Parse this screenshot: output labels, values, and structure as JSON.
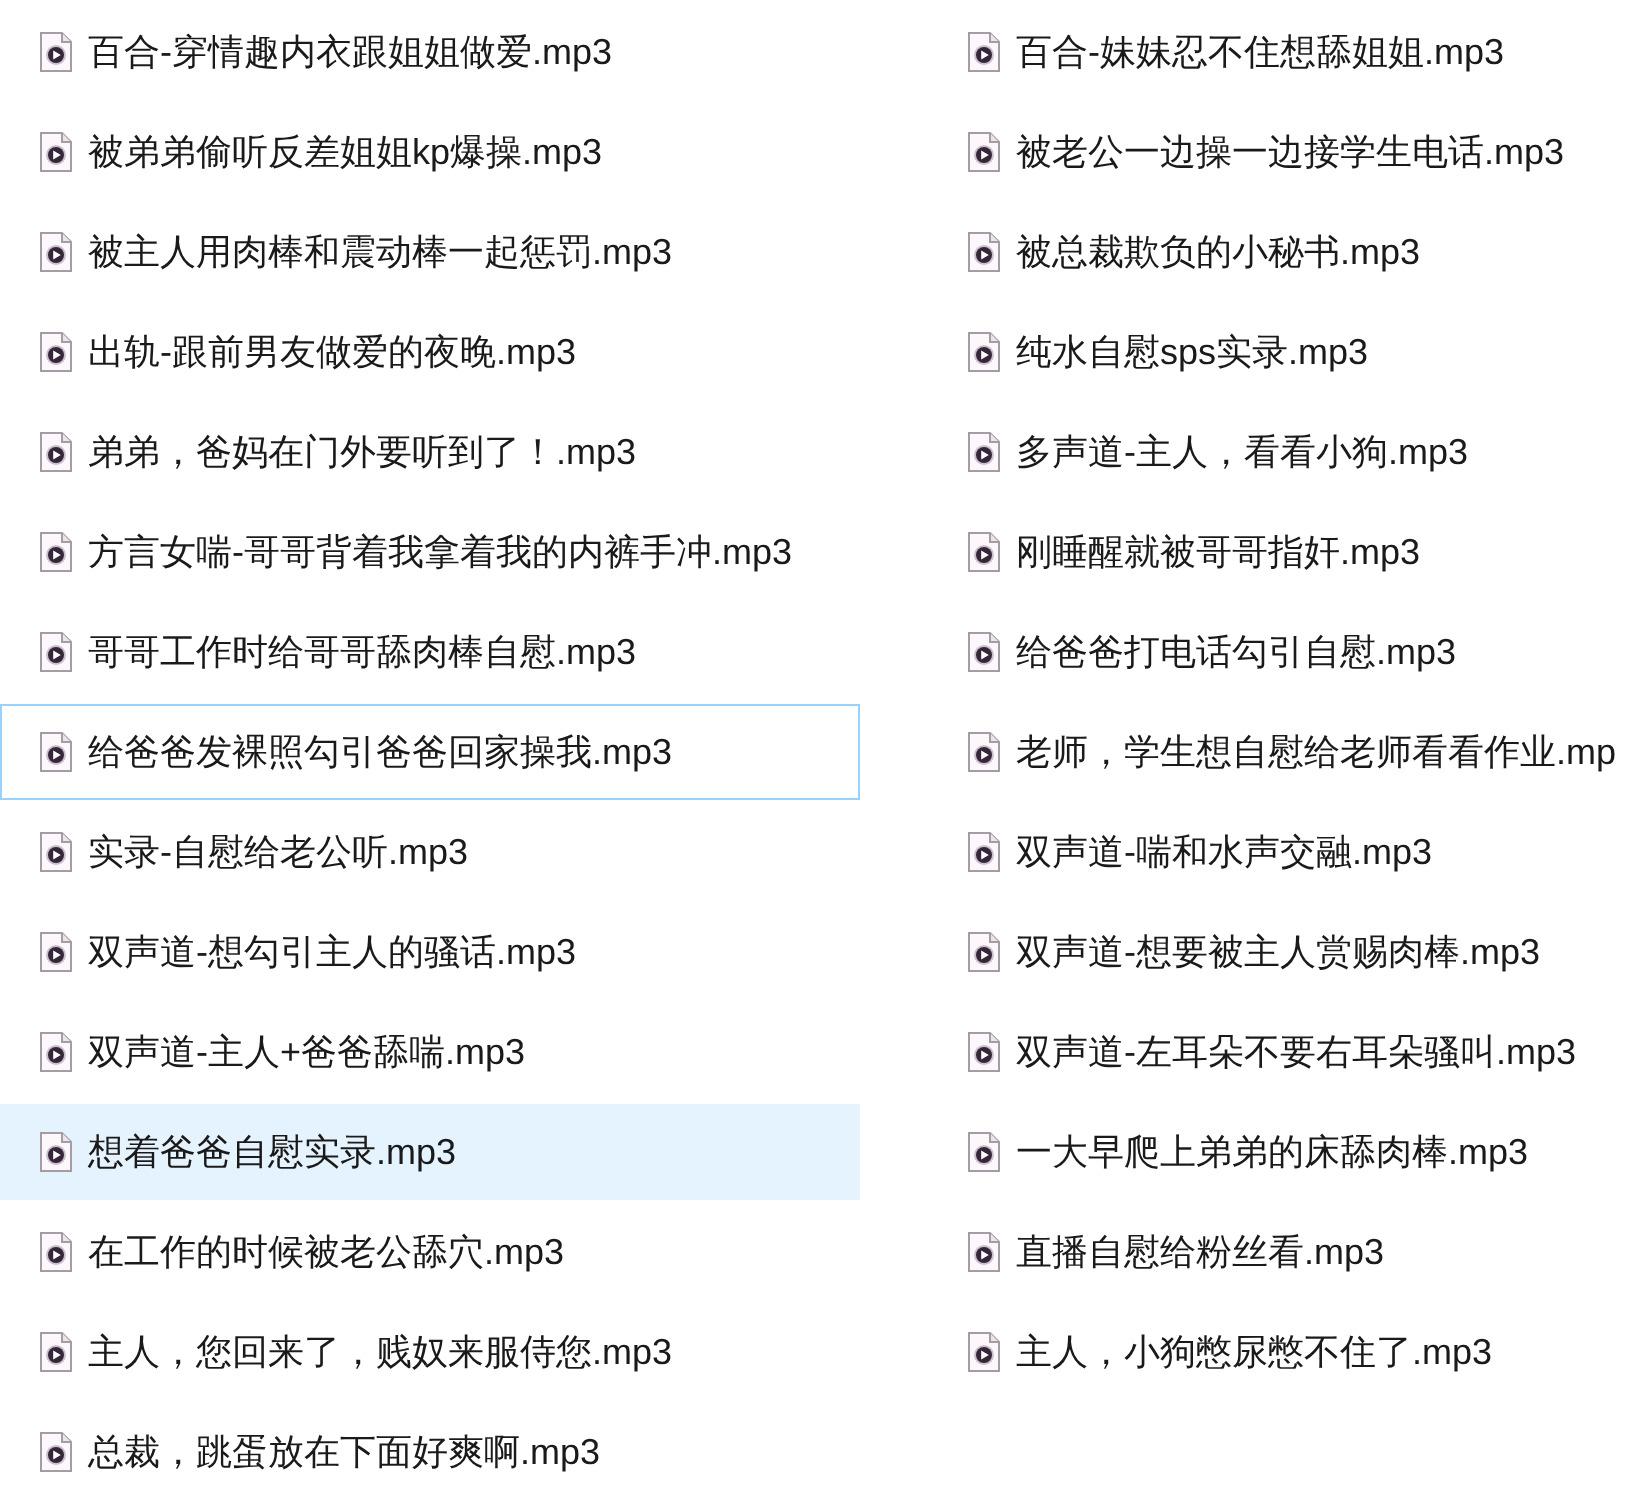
{
  "files": [
    {
      "name": "百合-穿情趣内衣跟姐姐做爱.mp3",
      "selected": false,
      "hovered": false,
      "focused": false
    },
    {
      "name": "百合-妹妹忍不住想舔姐姐.mp3",
      "selected": false,
      "hovered": false,
      "focused": false
    },
    {
      "name": "被弟弟偷听反差姐姐kp爆操.mp3",
      "selected": false,
      "hovered": false,
      "focused": false
    },
    {
      "name": "被老公一边操一边接学生电话.mp3",
      "selected": false,
      "hovered": false,
      "focused": false
    },
    {
      "name": "被主人用肉棒和震动棒一起惩罚.mp3",
      "selected": false,
      "hovered": false,
      "focused": false
    },
    {
      "name": "被总裁欺负的小秘书.mp3",
      "selected": false,
      "hovered": false,
      "focused": false
    },
    {
      "name": "出轨-跟前男友做爱的夜晚.mp3",
      "selected": false,
      "hovered": false,
      "focused": false
    },
    {
      "name": "纯水自慰sps实录.mp3",
      "selected": false,
      "hovered": false,
      "focused": false
    },
    {
      "name": "弟弟，爸妈在门外要听到了！.mp3",
      "selected": false,
      "hovered": false,
      "focused": false
    },
    {
      "name": "多声道-主人，看看小狗.mp3",
      "selected": false,
      "hovered": false,
      "focused": false
    },
    {
      "name": "方言女喘-哥哥背着我拿着我的内裤手冲.mp3",
      "selected": false,
      "hovered": false,
      "focused": false
    },
    {
      "name": "刚睡醒就被哥哥指奸.mp3",
      "selected": false,
      "hovered": false,
      "focused": false
    },
    {
      "name": "哥哥工作时给哥哥舔肉棒自慰.mp3",
      "selected": false,
      "hovered": false,
      "focused": false
    },
    {
      "name": "给爸爸打电话勾引自慰.mp3",
      "selected": false,
      "hovered": false,
      "focused": false
    },
    {
      "name": "给爸爸发裸照勾引爸爸回家操我.mp3",
      "selected": false,
      "hovered": false,
      "focused": true
    },
    {
      "name": "老师，学生想自慰给老师看看作业.mp",
      "selected": false,
      "hovered": false,
      "focused": false
    },
    {
      "name": "实录-自慰给老公听.mp3",
      "selected": false,
      "hovered": false,
      "focused": false
    },
    {
      "name": "双声道-喘和水声交融.mp3",
      "selected": false,
      "hovered": false,
      "focused": false
    },
    {
      "name": "双声道-想勾引主人的骚话.mp3",
      "selected": false,
      "hovered": false,
      "focused": false
    },
    {
      "name": "双声道-想要被主人赏赐肉棒.mp3",
      "selected": false,
      "hovered": false,
      "focused": false
    },
    {
      "name": "双声道-主人+爸爸舔喘.mp3",
      "selected": false,
      "hovered": false,
      "focused": false
    },
    {
      "name": "双声道-左耳朵不要右耳朵骚叫.mp3",
      "selected": false,
      "hovered": false,
      "focused": false
    },
    {
      "name": "想着爸爸自慰实录.mp3",
      "selected": false,
      "hovered": true,
      "focused": false
    },
    {
      "name": "一大早爬上弟弟的床舔肉棒.mp3",
      "selected": false,
      "hovered": false,
      "focused": false
    },
    {
      "name": "在工作的时候被老公舔穴.mp3",
      "selected": false,
      "hovered": false,
      "focused": false
    },
    {
      "name": "直播自慰给粉丝看.mp3",
      "selected": false,
      "hovered": false,
      "focused": false
    },
    {
      "name": "主人，您回来了，贱奴来服侍您.mp3",
      "selected": false,
      "hovered": false,
      "focused": false
    },
    {
      "name": "主人，小狗憋尿憋不住了.mp3",
      "selected": false,
      "hovered": false,
      "focused": false
    },
    {
      "name": "总裁，跳蛋放在下面好爽啊.mp3",
      "selected": false,
      "hovered": false,
      "focused": false
    }
  ]
}
